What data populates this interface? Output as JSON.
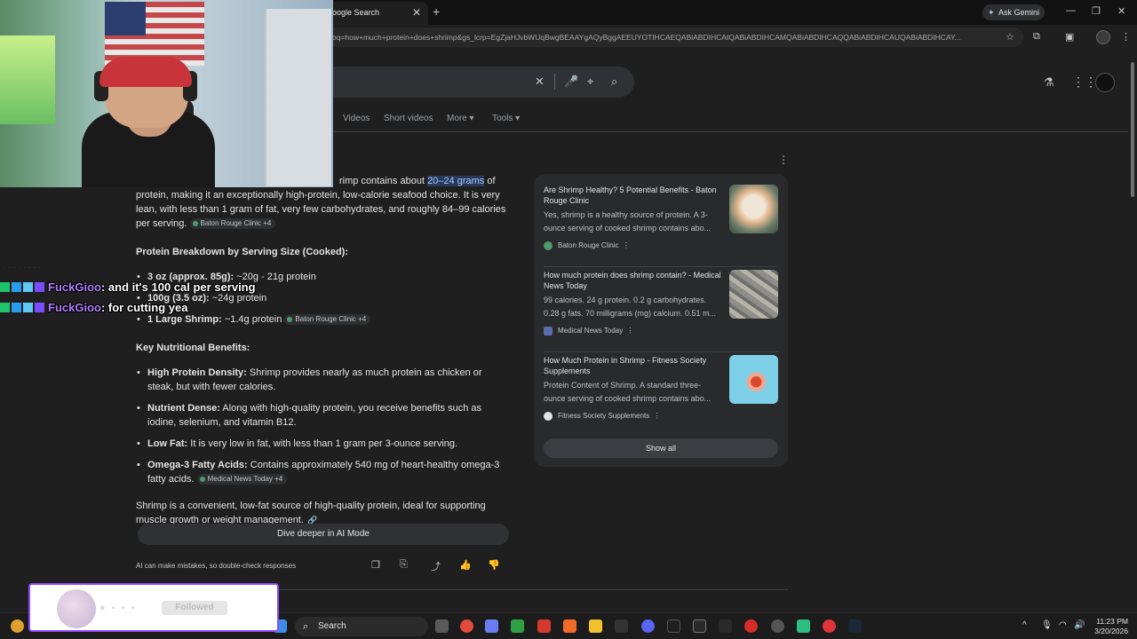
{
  "browser": {
    "tab_title": "oogle Search",
    "tab_close": "✕",
    "new_tab": "+",
    "ask_gemini": "Ask Gemini",
    "url": "oq=how+much+protein+does+shrimp&gs_lcrp=EgZjaHJvbWUqBwgBEAAYgAQyBggAEEUYOTIHCAEQABiABDIHCAIQABiABDIHCAMQABiABDIHCAQQABiABDIHCAUQABiABDIHCAY..."
  },
  "search": {
    "clear_icon": "✕",
    "mic_icon": "🎤",
    "lens_icon": "⌖",
    "search_icon": "⌕"
  },
  "filters": {
    "videos": "Videos",
    "short_videos": "Short videos",
    "more": "More ▾",
    "tools": "Tools ▾"
  },
  "ai_overview": {
    "intro_pre": "rimp contains about",
    "intro_highlight": "20–24 grams",
    "intro_post": "of protein, making it an exceptionally high-protein, low-calorie seafood choice. It is very lean, with less than 1 gram of fat, very few carbohydrates, and roughly 84–99 calories per serving.",
    "intro_chip": "Baton Rouge Clinic +4",
    "breakdown_heading": "Protein Breakdown by Serving Size (Cooked):",
    "breakdown": [
      {
        "label": "3 oz (approx. 85g):",
        "text": "~20g - 21g protein",
        "chip": ""
      },
      {
        "label": "100g (3.5 oz):",
        "text": "~24g protein",
        "chip": ""
      },
      {
        "label": "1 Large Shrimp:",
        "text": "~1.4g protein",
        "chip": "Baton Rouge Clinic +4"
      }
    ],
    "benefits_heading": "Key Nutritional Benefits:",
    "benefits": [
      {
        "label": "High Protein Density:",
        "text": "Shrimp provides nearly as much protein as chicken or steak, but with fewer calories.",
        "chip": ""
      },
      {
        "label": "Nutrient Dense:",
        "text": "Along with high-quality protein, you receive benefits such as iodine, selenium, and vitamin B12.",
        "chip": ""
      },
      {
        "label": "Low Fat:",
        "text": "It is very low in fat, with less than 1 gram per 3-ounce serving.",
        "chip": ""
      },
      {
        "label": "Omega-3 Fatty Acids:",
        "text": "Contains approximately 540 mg of heart-healthy omega-3 fatty acids.",
        "chip": "Medical News Today +4"
      }
    ],
    "conclusion": "Shrimp is a convenient, low-fat source of high-quality protein, ideal for supporting muscle growth or weight management.",
    "dive_deeper": "Dive deeper in AI Mode",
    "disclaimer": "AI can make mistakes, so double-check responses"
  },
  "sources": {
    "items": [
      {
        "title": "Are Shrimp Healthy? 5 Potential Benefits - Baton Rouge Clinic",
        "snippet": "Yes, shrimp is a healthy source of protein. A 3-ounce serving of cooked shrimp contains abo...",
        "site": "Baton Rouge Clinic"
      },
      {
        "title": "How much protein does shrimp contain? - Medical News Today",
        "snippet": "99 calories. 24 g protein. 0.2 g carbohydrates. 0.28 g fats. 70 milligrams (mg) calcium. 0.51 m...",
        "site": "Medical News Today"
      },
      {
        "title": "How Much Protein in Shrimp - Fitness Society Supplements",
        "snippet": "Protein Content of Shrimp. A standard three-ounce serving of cooked shrimp contains abo...",
        "site": "Fitness Society Supplements"
      }
    ],
    "show_all": "Show all"
  },
  "chat": {
    "messages": [
      {
        "user": "FuckGioo",
        "text": ": and it's 100 cal per serving"
      },
      {
        "user": "FuckGioo",
        "text": ": for cutting yea"
      }
    ]
  },
  "follow_alert": {
    "label": "Followed"
  },
  "taskbar": {
    "search_label": "Search",
    "time": "11:23 PM",
    "date": "3/20/2026"
  },
  "colors": {
    "highlight": "#283a5c",
    "chat_user": "#b07cff",
    "follow_border": "#9146ff"
  }
}
